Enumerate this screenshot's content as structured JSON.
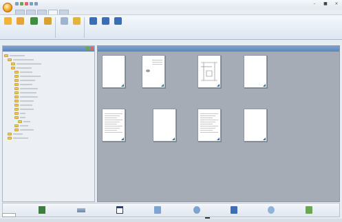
{
  "window": {
    "title": ""
  },
  "tabs": [
    {
      "label": "",
      "active": false
    },
    {
      "label": "",
      "active": false
    },
    {
      "label": "",
      "active": false
    },
    {
      "label": "",
      "active": true
    },
    {
      "label": "",
      "active": false
    }
  ],
  "ribbon": {
    "buttons": [
      {
        "label": "",
        "icon": "folder-up-icon",
        "color": "#f2b33d"
      },
      {
        "label": "",
        "icon": "folder-icon",
        "color": "#e8a33b"
      },
      {
        "label": "",
        "icon": "globe-icon",
        "color": "#3e8f3e"
      },
      {
        "label": "",
        "icon": "folder-share-icon",
        "color": "#d9a037"
      },
      {
        "label": "",
        "icon": "copy-icon",
        "color": "#9fb3cc"
      },
      {
        "label": "",
        "icon": "lock-icon",
        "color": "#e3b33f"
      },
      {
        "label": "",
        "icon": "view-icon",
        "color": "#3a6fb5"
      },
      {
        "label": "",
        "icon": "pages-icon",
        "color": "#3a6fb5"
      },
      {
        "label": "",
        "icon": "scan-icon",
        "color": "#3a6fb5"
      }
    ],
    "groups": [
      "",
      "",
      ""
    ]
  },
  "folders_panel": {
    "title": "",
    "nodes": [
      "",
      "",
      "",
      "",
      "",
      "",
      "",
      "",
      "",
      "",
      "",
      "",
      "",
      "",
      "",
      "",
      "",
      "",
      "",
      "",
      "",
      ""
    ]
  },
  "thumbs_panel": {
    "title": "",
    "items": [
      {
        "caption": ""
      },
      {
        "caption": ""
      },
      {
        "caption": ""
      },
      {
        "caption": ""
      },
      {
        "caption": ""
      },
      {
        "caption": ""
      },
      {
        "caption": ""
      },
      {
        "caption": ""
      }
    ]
  },
  "bottom_toolbar": {
    "buttons": [
      "scan-to-image-icon",
      "email-icon",
      "ocr-icon",
      "file-icon",
      "print-icon",
      "share-icon",
      "web-icon",
      "app-icon"
    ]
  },
  "status": {
    "tab_label": "",
    "text": ""
  }
}
